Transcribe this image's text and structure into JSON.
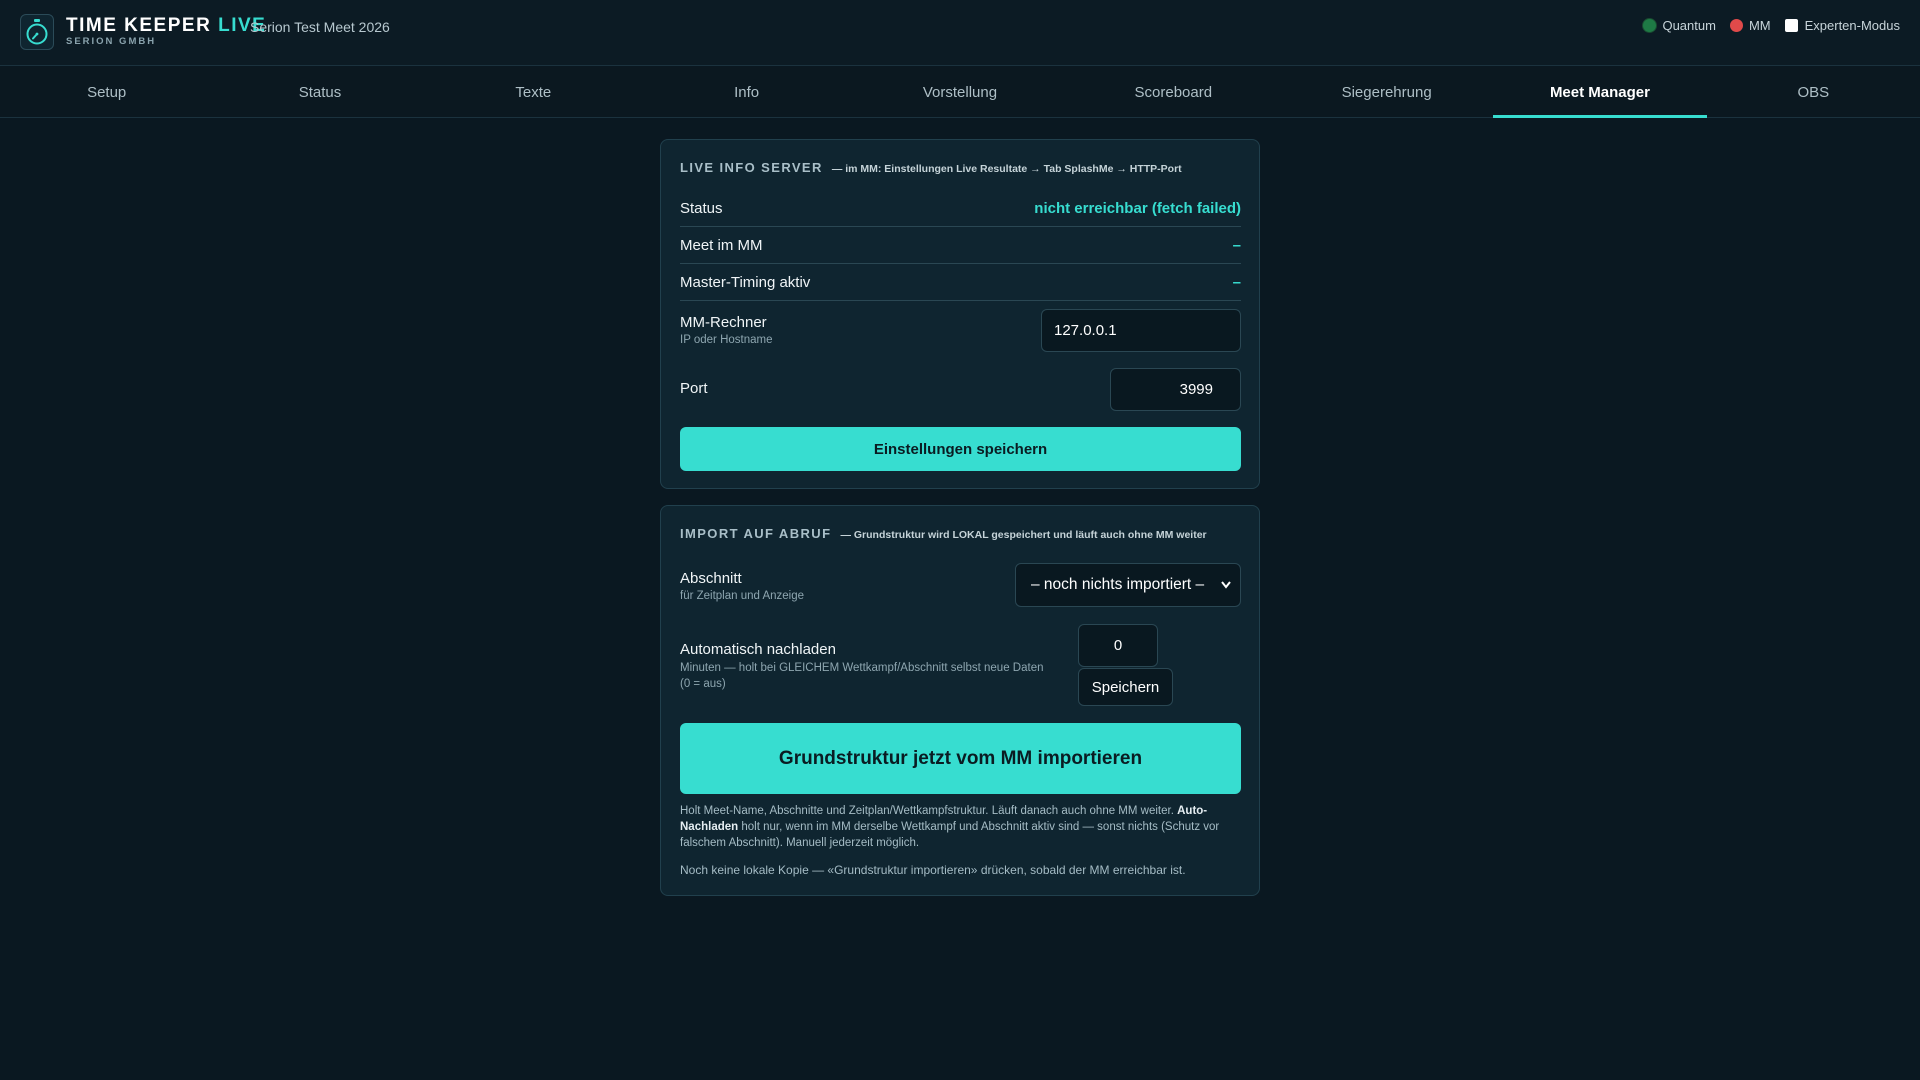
{
  "header": {
    "brand_main": "TIME KEEPER",
    "brand_accent": "LIVE",
    "brand_sub": "SERION GMBH",
    "meet_name": "Serion Test Meet 2026",
    "indicators": [
      {
        "label": "Quantum",
        "color": "#1e7a45"
      },
      {
        "label": "MM",
        "color": "#e04a4a"
      }
    ],
    "expert_mode_label": "Experten-Modus",
    "expert_mode_checked": false
  },
  "tabs": [
    {
      "label": "Setup",
      "active": false
    },
    {
      "label": "Status",
      "active": false
    },
    {
      "label": "Texte",
      "active": false
    },
    {
      "label": "Info",
      "active": false
    },
    {
      "label": "Vorstellung",
      "active": false
    },
    {
      "label": "Scoreboard",
      "active": false
    },
    {
      "label": "Siegerehrung",
      "active": false
    },
    {
      "label": "Meet Manager",
      "active": true
    },
    {
      "label": "OBS",
      "active": false
    }
  ],
  "live_info": {
    "title": "LIVE INFO SERVER",
    "hint": "— im MM: Einstellungen Live Resultate → Tab SplashMe → HTTP-Port",
    "rows": [
      {
        "label": "Status",
        "value": "nicht erreichbar (fetch failed)"
      },
      {
        "label": "Meet im MM",
        "value": "–"
      },
      {
        "label": "Master-Timing aktiv",
        "value": "–"
      }
    ],
    "host_label": "MM-Rechner",
    "host_sub": "IP oder Hostname",
    "host_value": "127.0.0.1",
    "port_label": "Port",
    "port_value": "3999",
    "save_label": "Einstellungen speichern"
  },
  "import": {
    "title": "IMPORT AUF ABRUF",
    "hint": "— Grundstruktur wird LOKAL gespeichert und läuft auch ohne MM weiter",
    "section_label": "Abschnitt",
    "section_sub": "für Zeitplan und Anzeige",
    "section_selected": "– noch nichts importiert –",
    "reload_label": "Automatisch nachladen",
    "reload_sub_1": "Minuten — holt bei GLEICHEM Wettkampf/Abschnitt selbst neue Daten",
    "reload_sub_2": "(0 = aus)",
    "reload_value": "0",
    "reload_save_label": "Speichern",
    "import_button_label": "Grundstruktur jetzt vom MM importieren",
    "help_part1": "Holt Meet-Name, Abschnitte und Zeitplan/Wettkampfstruktur. Läuft danach auch ohne MM weiter. ",
    "help_bold": "Auto-Nachladen",
    "help_part2": " holt nur, wenn im MM derselbe Wettkampf und Abschnitt aktiv sind — sonst nichts (Schutz vor falschem Abschnitt). Manuell jederzeit möglich.",
    "local_copy_note": "Noch keine lokale Kopie — «Grundstruktur importieren» drücken, sobald der MM erreichbar ist."
  },
  "colors": {
    "accent": "#37ddd0",
    "background": "#0a1821",
    "panel": "#0f2530"
  }
}
